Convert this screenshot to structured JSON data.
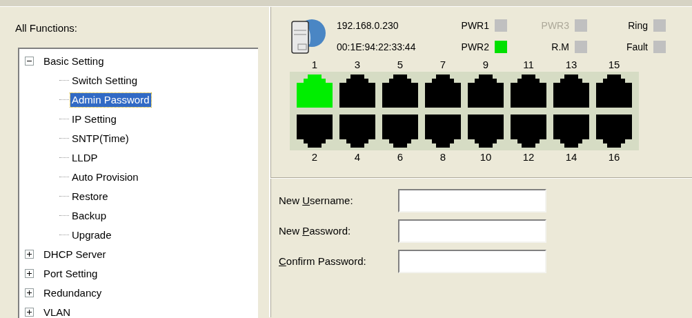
{
  "sidebar": {
    "title": "All Functions:",
    "tree": [
      {
        "label": "Basic Setting",
        "expanded": true,
        "selected": false,
        "children": [
          {
            "label": "Switch Setting",
            "selected": false
          },
          {
            "label": "Admin Password",
            "selected": true
          },
          {
            "label": "IP Setting",
            "selected": false
          },
          {
            "label": "SNTP(Time)",
            "selected": false
          },
          {
            "label": "LLDP",
            "selected": false
          },
          {
            "label": "Auto Provision",
            "selected": false
          },
          {
            "label": "Restore",
            "selected": false
          },
          {
            "label": "Backup",
            "selected": false
          },
          {
            "label": "Upgrade",
            "selected": false
          }
        ]
      },
      {
        "label": "DHCP Server",
        "expanded": false,
        "selected": false
      },
      {
        "label": "Port Setting",
        "expanded": false,
        "selected": false
      },
      {
        "label": "Redundancy",
        "expanded": false,
        "selected": false
      },
      {
        "label": "VLAN",
        "expanded": false,
        "selected": false
      }
    ]
  },
  "device": {
    "ip": "192.168.0.230",
    "mac": "00:1E:94:22:33:44",
    "indicators": [
      {
        "label": "PWR1",
        "on": false,
        "disabled": false
      },
      {
        "label": "PWR3",
        "on": false,
        "disabled": true
      },
      {
        "label": "Ring",
        "on": false,
        "disabled": false
      },
      {
        "label": "PWR2",
        "on": true,
        "disabled": false
      },
      {
        "label": "R.M",
        "on": false,
        "disabled": false
      },
      {
        "label": "Fault",
        "on": false,
        "disabled": false
      }
    ],
    "ports": [
      {
        "number": "1",
        "link": true
      },
      {
        "number": "2",
        "link": false
      },
      {
        "number": "3",
        "link": false
      },
      {
        "number": "4",
        "link": false
      },
      {
        "number": "5",
        "link": false
      },
      {
        "number": "6",
        "link": false
      },
      {
        "number": "7",
        "link": false
      },
      {
        "number": "8",
        "link": false
      },
      {
        "number": "9",
        "link": false
      },
      {
        "number": "10",
        "link": false
      },
      {
        "number": "11",
        "link": false
      },
      {
        "number": "12",
        "link": false
      },
      {
        "number": "13",
        "link": false
      },
      {
        "number": "14",
        "link": false
      },
      {
        "number": "15",
        "link": false
      },
      {
        "number": "16",
        "link": false
      }
    ]
  },
  "form": {
    "fields": [
      {
        "label": {
          "before": "New ",
          "key": "U",
          "after": "sername:"
        }
      },
      {
        "label": {
          "before": "New ",
          "key": "P",
          "after": "assword:"
        }
      },
      {
        "label": {
          "key": "C",
          "after": "onfirm Password:"
        }
      }
    ]
  }
}
